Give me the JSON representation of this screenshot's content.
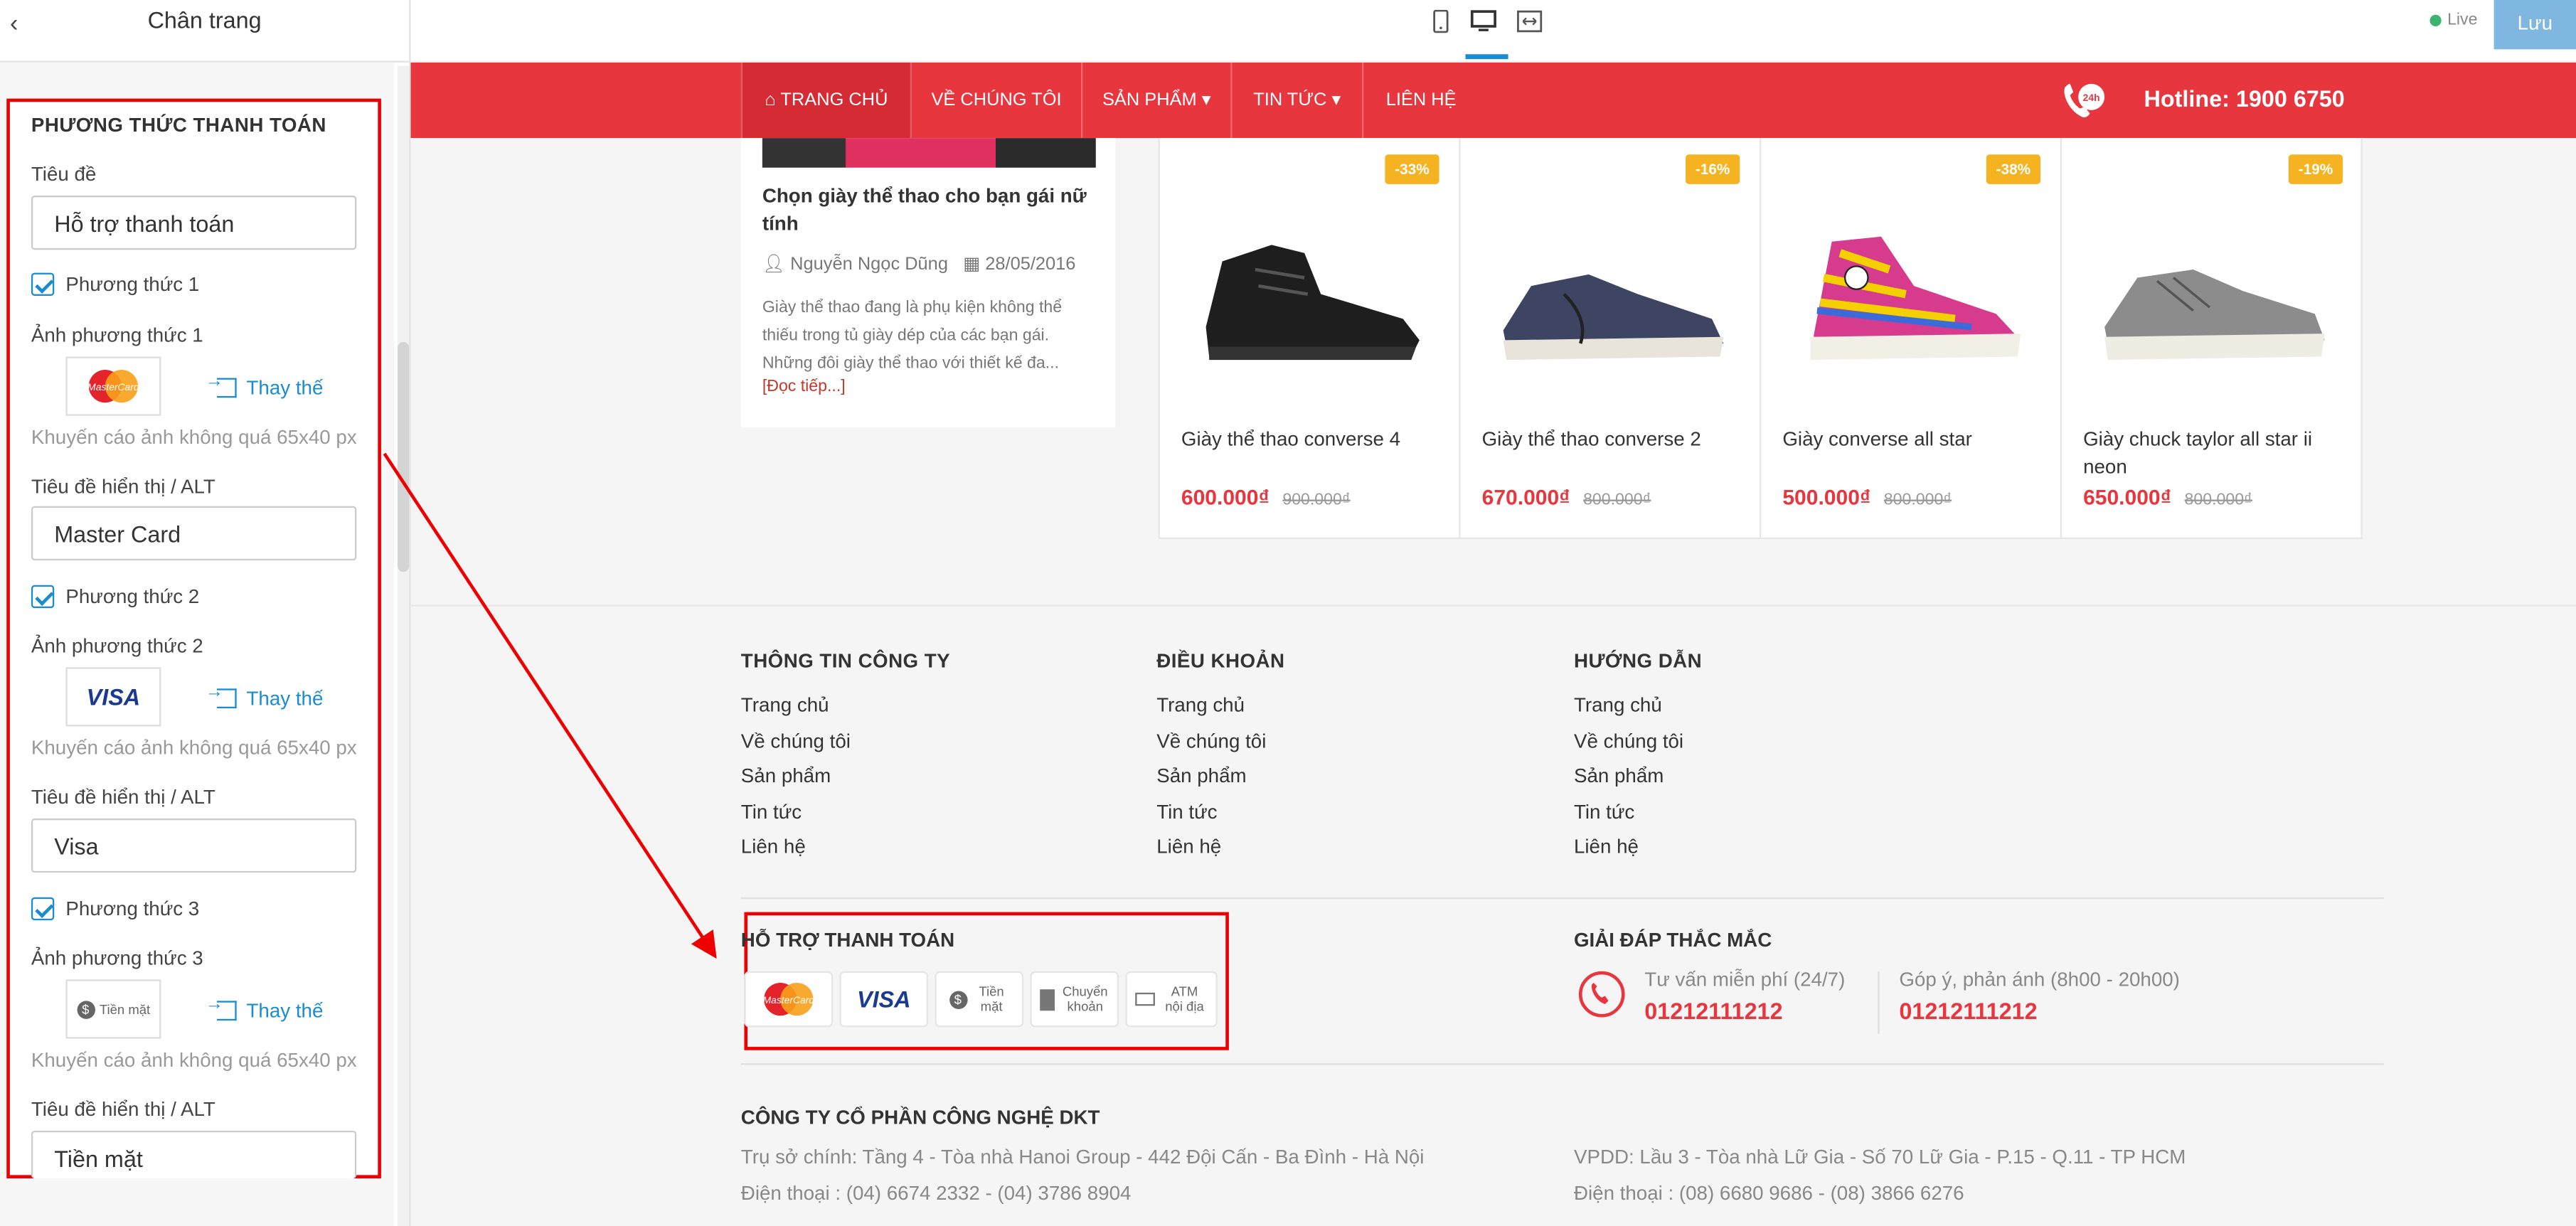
{
  "panel": {
    "back_glyph": "‹",
    "title": "Chân trang",
    "section_title": "PHƯƠNG THỨC THANH TOÁN",
    "title_label": "Tiêu đề",
    "title_value": "Hỗ trợ thanh toán",
    "methods": [
      {
        "check_label": "Phương thức 1",
        "image_label": "Ảnh phương thức 1",
        "replace": "Thay thế",
        "hint": "Khuyến cáo ảnh không quá 65x40 px",
        "alt_label": "Tiêu đề hiển thị / ALT",
        "alt_value": "Master Card"
      },
      {
        "check_label": "Phương thức 2",
        "image_label": "Ảnh phương thức 2",
        "replace": "Thay thế",
        "hint": "Khuyến cáo ảnh không quá 65x40 px",
        "alt_label": "Tiêu đề hiển thị / ALT",
        "alt_value": "Visa"
      },
      {
        "check_label": "Phương thức 3",
        "image_label": "Ảnh phương thức 3",
        "replace": "Thay thế",
        "hint": "Khuyến cáo ảnh không quá 65x40 px",
        "alt_label": "Tiêu đề hiển thị / ALT",
        "alt_value": "Tiền mặt"
      }
    ]
  },
  "toolbar": {
    "live": "Live",
    "save": "Lưu"
  },
  "nav": {
    "items": [
      "TRANG CHỦ",
      "VỀ CHÚNG TÔI",
      "SẢN PHẨM",
      "TIN TỨC",
      "LIÊN HỆ"
    ],
    "hotline": "Hotline: 1900 6750"
  },
  "blog": {
    "title": "Chọn giày thể thao cho bạn gái nữ tính",
    "author": "Nguyễn Ngọc Dũng",
    "date": "28/05/2016",
    "desc": "Giày thể thao đang là phụ kiện không thể thiếu trong tủ giày dép của các bạn gái. Những đôi giày thể thao với thiết kế đa...",
    "more": "[Đọc tiếp...]"
  },
  "products": [
    {
      "badge": "-33%",
      "name": "Giày thể thao converse 4",
      "price": "600.000₫",
      "old": "900.000₫"
    },
    {
      "badge": "-16%",
      "name": "Giày thể thao converse 2",
      "price": "670.000₫",
      "old": "800.000₫"
    },
    {
      "badge": "-38%",
      "name": "Giày converse all star",
      "price": "500.000₫",
      "old": "800.000₫"
    },
    {
      "badge": "-19%",
      "name": "Giày chuck taylor all star ii neon",
      "price": "650.000₫",
      "old": "800.000₫"
    }
  ],
  "footer": {
    "cols": [
      {
        "title": "THÔNG TIN CÔNG TY",
        "links": [
          "Trang chủ",
          "Về chúng tôi",
          "Sản phẩm",
          "Tin tức",
          "Liên hệ"
        ]
      },
      {
        "title": "ĐIỀU KHOẢN",
        "links": [
          "Trang chủ",
          "Về chúng tôi",
          "Sản phẩm",
          "Tin tức",
          "Liên hệ"
        ]
      },
      {
        "title": "HƯỚNG DẪN",
        "links": [
          "Trang chủ",
          "Về chúng tôi",
          "Sản phẩm",
          "Tin tức",
          "Liên hệ"
        ]
      }
    ],
    "payment_title": "HỖ TRỢ THANH TOÁN",
    "payment_icons": [
      "MasterCard",
      "VISA",
      "Tiền mặt",
      "Chuyển khoản",
      "ATM nội địa"
    ],
    "faq_title": "GIẢI ĐÁP THẮC MẮC",
    "faq": [
      {
        "label": "Tư vấn miễn phí (24/7)",
        "number": "01212111212"
      },
      {
        "label": "Góp ý, phản ánh (8h00 - 20h00)",
        "number": "01212111212"
      }
    ],
    "company": "CÔNG TY CỔ PHẦN CÔNG NGHỆ DKT",
    "hq": "Trụ sở chính: Tầng 4 - Tòa nhà Hanoi Group - 442 Đội Cấn - Ba Đình - Hà Nội",
    "hq_phone": "Điện thoại : (04) 6674 2332 - (04) 3786 8904",
    "rep": "VPDD: Lầu 3 - Tòa nhà Lữ Gia - Số 70 Lữ Gia - P.15 - Q.11 - TP HCM",
    "rep_phone": "Điện thoại : (08) 6680 9686 - (08) 3866 6276"
  },
  "colors": {
    "brand_red": "#e8363f",
    "accent_blue": "#1a8ccf",
    "badge_yellow": "#f6b321",
    "annotation_red": "#ee0000"
  },
  "icons": [
    "back-icon",
    "mobile-icon",
    "desktop-icon",
    "fullwidth-icon",
    "home-icon",
    "hotline-icon",
    "user-icon",
    "calendar-icon",
    "phone-icon",
    "replace-icon",
    "checkbox-icon"
  ]
}
